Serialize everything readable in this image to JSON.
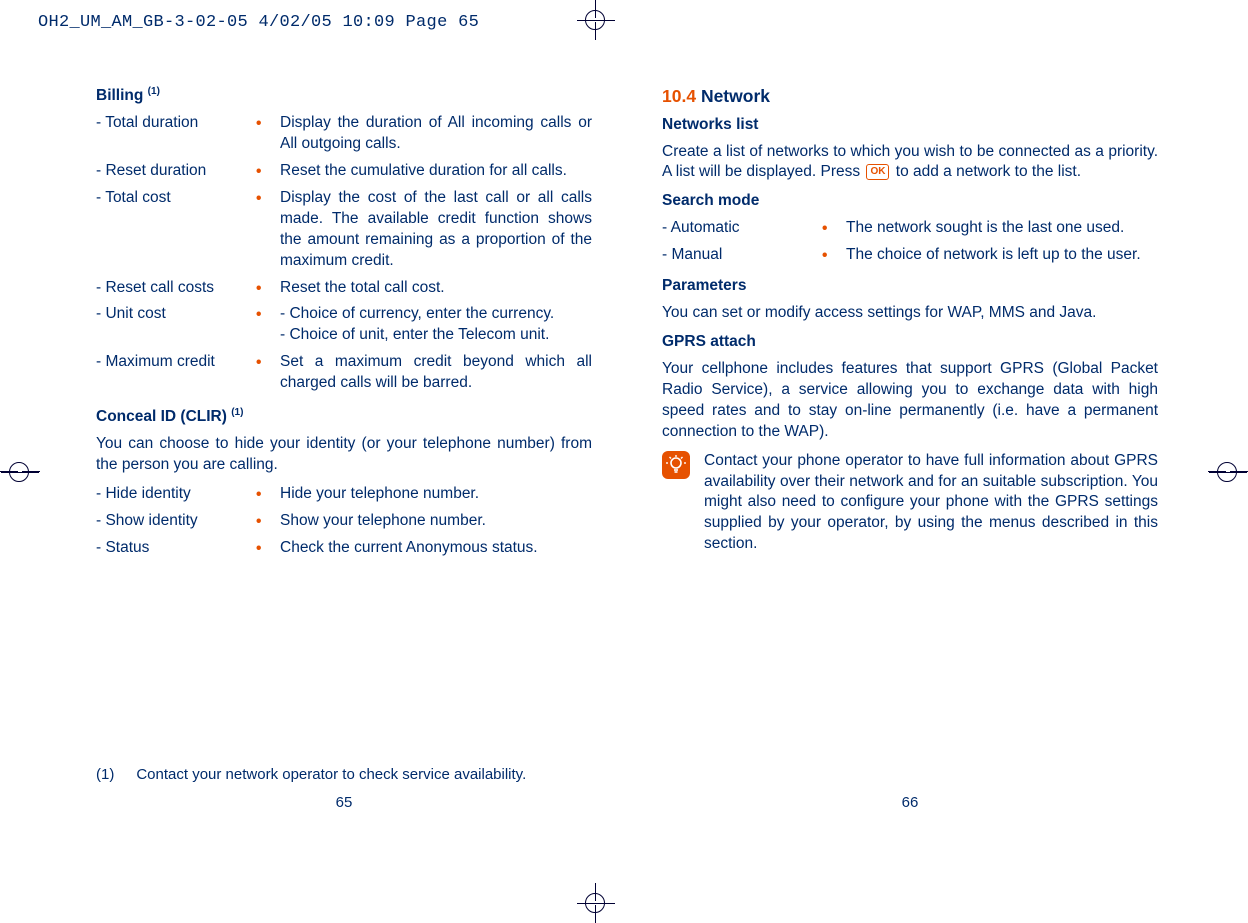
{
  "print_header": "OH2_UM_AM_GB-3-02-05   4/02/05  10:09  Page 65",
  "left": {
    "billing_heading": "Billing",
    "billing_sup": "(1)",
    "billing_items": [
      {
        "term": "- Total duration",
        "desc": "Display the duration of All incoming calls or All outgoing calls."
      },
      {
        "term": "- Reset duration",
        "desc": "Reset the cumulative duration for all calls."
      },
      {
        "term": "- Total cost",
        "desc": "Display the cost of the last call or all calls made. The available credit function shows the amount remaining as a proportion of the maximum credit."
      },
      {
        "term": "- Reset call costs",
        "desc": "Reset the total call cost."
      },
      {
        "term": "- Unit cost",
        "desc": "- Choice of currency, enter the currency.\n- Choice of unit, enter the Telecom unit."
      },
      {
        "term": "- Maximum credit",
        "desc": "Set a maximum credit beyond which all charged calls will be barred."
      }
    ],
    "conceal_heading": "Conceal ID (CLIR)",
    "conceal_sup": "(1)",
    "conceal_intro": "You can choose to hide your identity (or your telephone number) from the person you are calling.",
    "conceal_items": [
      {
        "term": "- Hide identity",
        "desc": "Hide your telephone number."
      },
      {
        "term": "- Show identity",
        "desc": "Show your telephone number."
      },
      {
        "term": "- Status",
        "desc": "Check the current Anonymous status."
      }
    ],
    "footnote_marker": "(1)",
    "footnote_text": "Contact your network operator to check service availability.",
    "page_number": "65"
  },
  "right": {
    "section_number": "10.4",
    "section_title": "Network",
    "networks_heading": "Networks list",
    "networks_body_1": "Create a list of networks to which you wish to be connected as a priority. A list will be displayed. Press",
    "ok_label": "OK",
    "networks_body_2": "to add a network to the list.",
    "search_heading": "Search mode",
    "search_items": [
      {
        "term": "- Automatic",
        "desc": "The network sought is the last one used."
      },
      {
        "term": "- Manual",
        "desc": "The choice of network is left up to the user."
      }
    ],
    "params_heading": "Parameters",
    "params_body": "You can set or modify access settings for WAP, MMS and Java.",
    "gprs_heading": "GPRS attach",
    "gprs_body": "Your cellphone includes features that support GPRS (Global Packet Radio Service), a service allowing you to exchange data with high speed rates and to stay on-line permanently (i.e. have a permanent connection to the WAP).",
    "tip_body": "Contact your phone operator to have full information about GPRS availability over their network and for an suitable subscription. You might also need to configure your phone with the GPRS settings supplied by your operator, by using the menus described in this section.",
    "page_number": "66"
  }
}
